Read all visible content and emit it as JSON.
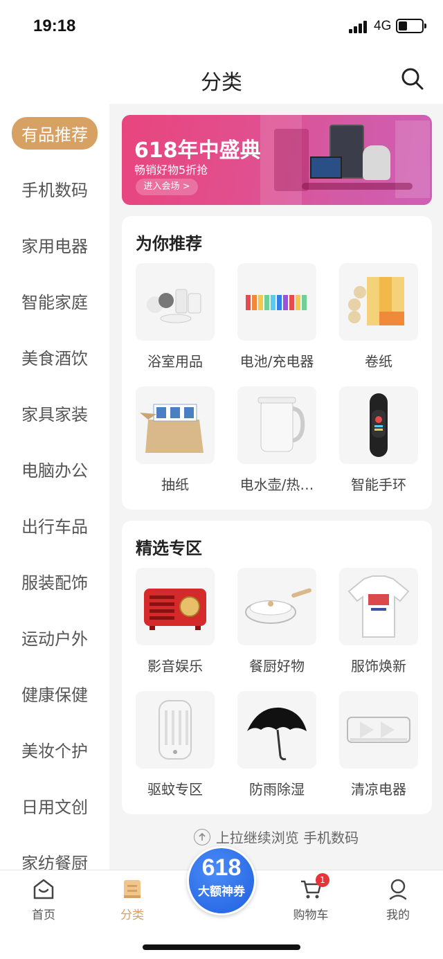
{
  "status_bar": {
    "time": "19:18",
    "network": "4G"
  },
  "nav": {
    "title": "分类",
    "search_icon": "search-icon"
  },
  "sidebar": {
    "items": [
      {
        "label": "有品推荐",
        "active": true
      },
      {
        "label": "手机数码"
      },
      {
        "label": "家用电器"
      },
      {
        "label": "智能家庭"
      },
      {
        "label": "美食酒饮"
      },
      {
        "label": "家具家装"
      },
      {
        "label": "电脑办公"
      },
      {
        "label": "出行车品"
      },
      {
        "label": "服装配饰"
      },
      {
        "label": "运动户外"
      },
      {
        "label": "健康保健"
      },
      {
        "label": "美妆个护"
      },
      {
        "label": "日用文创"
      },
      {
        "label": "家纺餐厨"
      }
    ]
  },
  "banner": {
    "title": "618年中盛典",
    "subtitle": "畅销好物5折抢",
    "button": "进入会场 >",
    "colors": [
      "#e8457d",
      "#cf5fb5"
    ]
  },
  "recommend": {
    "title": "为你推荐",
    "items": [
      {
        "label": "浴室用品",
        "icon": "bath-supplies-icon"
      },
      {
        "label": "电池/充电器",
        "icon": "battery-icon"
      },
      {
        "label": "卷纸",
        "icon": "toilet-paper-icon"
      },
      {
        "label": "抽纸",
        "icon": "tissue-box-icon"
      },
      {
        "label": "电水壶/热…",
        "icon": "kettle-icon"
      },
      {
        "label": "智能手环",
        "icon": "smart-band-icon"
      }
    ]
  },
  "featured": {
    "title": "精选专区",
    "items": [
      {
        "label": "影音娱乐",
        "icon": "radio-speaker-icon"
      },
      {
        "label": "餐厨好物",
        "icon": "frying-pan-icon"
      },
      {
        "label": "服饰焕新",
        "icon": "tshirt-icon"
      },
      {
        "label": "驱蚊专区",
        "icon": "mosquito-lamp-icon"
      },
      {
        "label": "防雨除湿",
        "icon": "umbrella-icon"
      },
      {
        "label": "清凉电器",
        "icon": "air-conditioner-icon"
      }
    ]
  },
  "footer_hint": "上拉继续浏览 手机数码",
  "tabbar": {
    "home": "首页",
    "category": "分类",
    "promo_num": "618",
    "promo_text": "大额神券",
    "cart": "购物车",
    "cart_badge": "1",
    "mine": "我的",
    "accent": "#d7a164",
    "promo_color": "#1f5fe0"
  }
}
